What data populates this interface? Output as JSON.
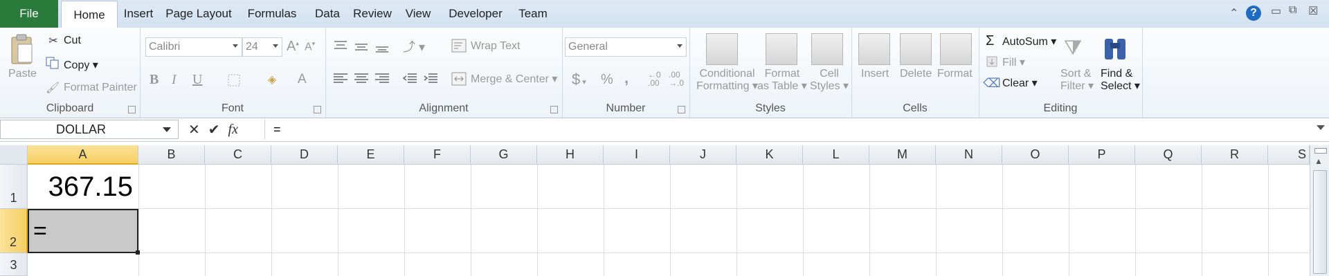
{
  "tabs": {
    "file": "File",
    "items": [
      "Home",
      "Insert",
      "Page Layout",
      "Formulas",
      "Data",
      "Review",
      "View",
      "Developer",
      "Team"
    ],
    "active": "Home"
  },
  "ribbon": {
    "clipboard": {
      "paste": "Paste",
      "cut": "Cut",
      "copy": "Copy",
      "format_painter": "Format Painter",
      "label": "Clipboard"
    },
    "font": {
      "font_name": "Calibri",
      "font_size": "24",
      "label": "Font",
      "bold": "B",
      "italic": "I",
      "underline": "U",
      "font_color_glyph": "A"
    },
    "alignment": {
      "wrap_text": "Wrap Text",
      "merge_center": "Merge & Center",
      "label": "Alignment"
    },
    "number": {
      "format": "General",
      "currency": "$",
      "percent": "%",
      "comma": ",",
      "label": "Number"
    },
    "styles": {
      "conditional_formatting_1": "Conditional",
      "conditional_formatting_2": "Formatting",
      "format_as_table_1": "Format",
      "format_as_table_2": "as Table",
      "cell_styles_1": "Cell",
      "cell_styles_2": "Styles",
      "label": "Styles"
    },
    "cells": {
      "insert": "Insert",
      "delete": "Delete",
      "format": "Format",
      "label": "Cells"
    },
    "editing": {
      "autosum": "AutoSum",
      "fill": "Fill",
      "clear": "Clear",
      "sort_filter_1": "Sort &",
      "sort_filter_2": "Filter",
      "find_select_1": "Find &",
      "find_select_2": "Select",
      "label": "Editing"
    }
  },
  "formula_bar": {
    "name_box": "DOLLAR",
    "formula": "=",
    "fx": "fx"
  },
  "columns": [
    "A",
    "B",
    "C",
    "D",
    "E",
    "F",
    "G",
    "H",
    "I",
    "J",
    "K",
    "L",
    "M",
    "N",
    "O",
    "P",
    "Q",
    "R",
    "S"
  ],
  "rows": [
    "1",
    "2",
    "3"
  ],
  "cells": {
    "A1": "367.15",
    "A2": "="
  },
  "colors": {
    "file_tab": "#2a7a3b",
    "selection_header": "#f6cf63",
    "editing_cell": "#c9c9c9"
  }
}
